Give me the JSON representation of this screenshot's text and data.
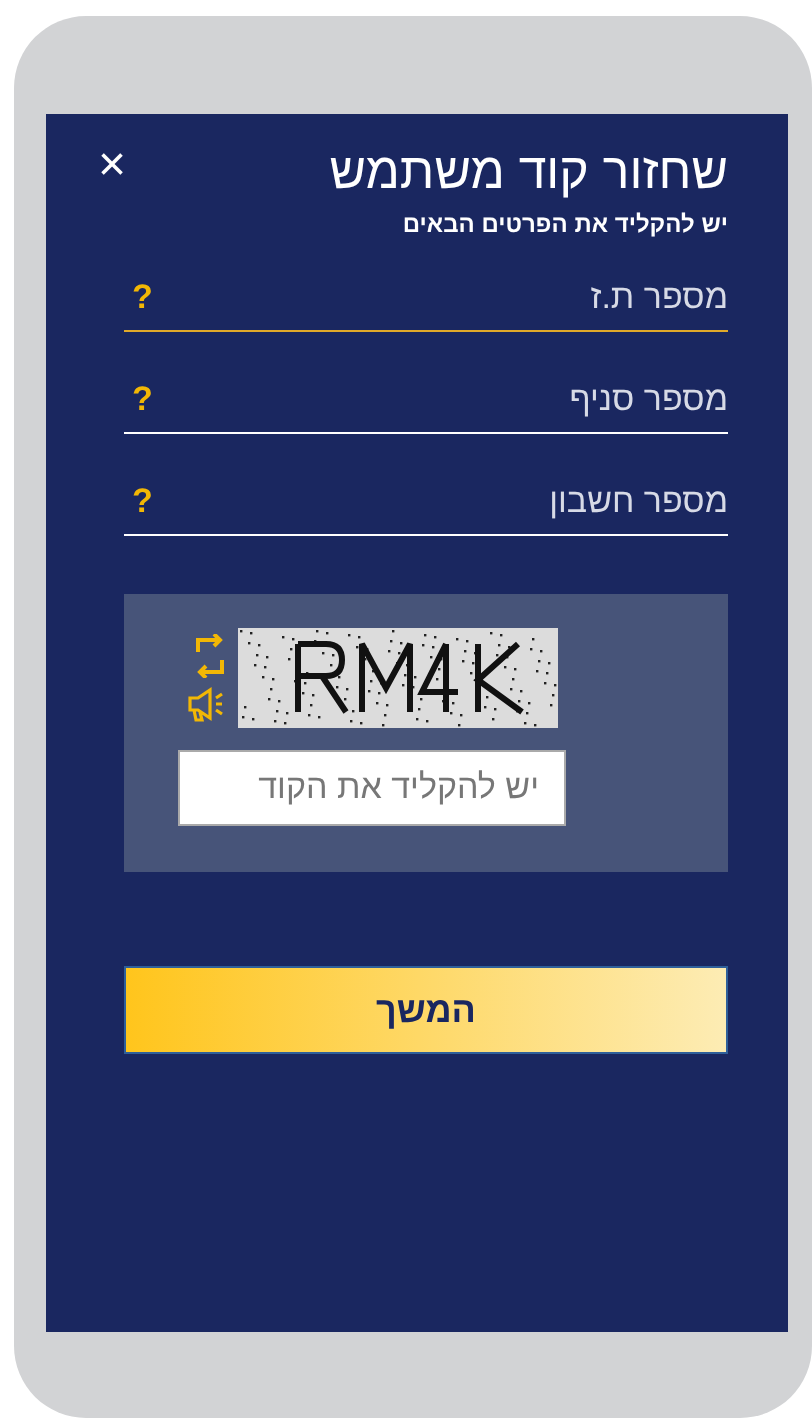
{
  "dialog": {
    "title": "שחזור קוד משתמש",
    "subtitle": "יש להקליד את הפרטים הבאים",
    "close": "×"
  },
  "fields": [
    {
      "placeholder": "מספר ת.ז",
      "help": "?",
      "focused": true
    },
    {
      "placeholder": "מספר סניף",
      "help": "?",
      "focused": false
    },
    {
      "placeholder": "מספר חשבון",
      "help": "?",
      "focused": false
    }
  ],
  "captcha": {
    "placeholder": "יש להקליד את הקוד"
  },
  "buttons": [
    {
      "label": "המשך"
    }
  ]
}
